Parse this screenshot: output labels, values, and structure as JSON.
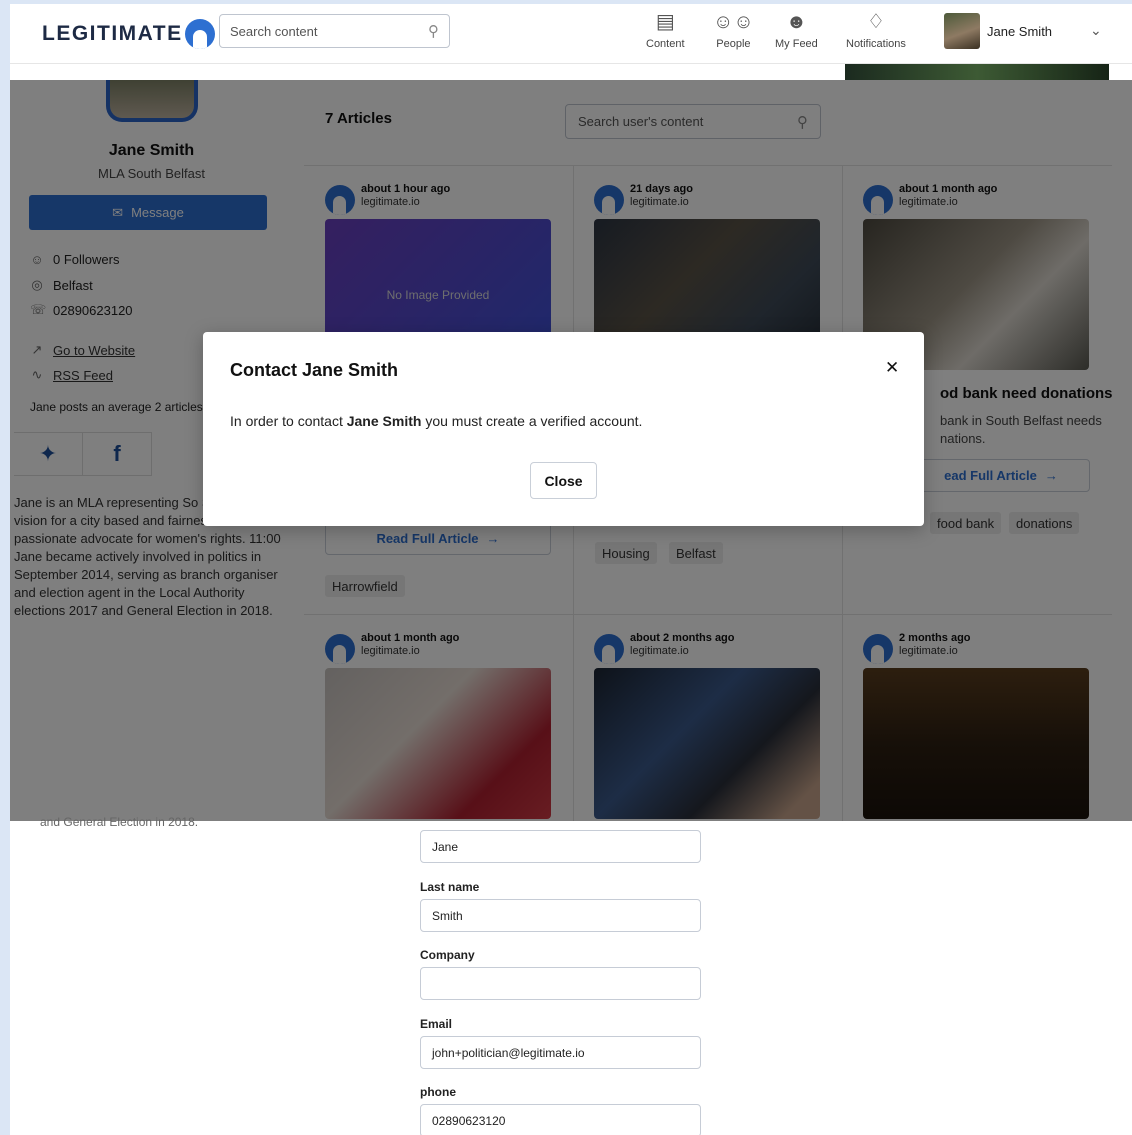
{
  "header": {
    "logo_text": "LEGITIMATE",
    "search_placeholder": "Search content",
    "nav": [
      {
        "label": "Content",
        "icon": "newspaper-icon"
      },
      {
        "label": "People",
        "icon": "people-icon"
      },
      {
        "label": "My Feed",
        "icon": "my-feed-icon"
      },
      {
        "label": "Notifications",
        "icon": "bell-icon"
      }
    ],
    "user_name": "Jane Smith"
  },
  "profile": {
    "name": "Jane Smith",
    "role": "MLA South Belfast",
    "message_label": "Message",
    "followers": "0 Followers",
    "location": "Belfast",
    "phone": "02890623120",
    "website_label": "Go to Website",
    "rss_label": "RSS Feed",
    "avg_posts": "Jane posts an average 2 articles",
    "bio": "Jane is an MLA representing So She has a vision for a city based and fairness and is a passionate advocate for women's rights. 11:00 Jane became actively involved in politics in September 2014, serving as branch organiser and election agent in the Local Authority elections 2017 and General Election in 2018."
  },
  "articles": {
    "count_label": "7 Articles",
    "search_placeholder": "Search user's content",
    "cards": [
      {
        "time": "about 1 hour ago",
        "site": "legitimate.io",
        "no_image": "No Image Provided"
      },
      {
        "time": "21 days ago",
        "site": "legitimate.io"
      },
      {
        "time": "about 1 month ago",
        "site": "legitimate.io",
        "title": "od bank need donations",
        "desc": "bank in South Belfast needs nations."
      },
      {
        "time": "about 1 month ago",
        "site": "legitimate.io"
      },
      {
        "time": "about 2 months ago",
        "site": "legitimate.io"
      },
      {
        "time": "2 months ago",
        "site": "legitimate.io"
      }
    ],
    "read_full": "Read Full Article",
    "read_full_partial": "ead Full Article",
    "tags_card1": [
      "Harrowfield"
    ],
    "tags_card2": [
      "Housing",
      "Belfast"
    ],
    "tags_card3": [
      "food bank",
      "donations"
    ]
  },
  "modal": {
    "title": "Contact Jane Smith",
    "body_prefix": "In order to contact ",
    "body_name": "Jane Smith",
    "body_suffix": " you must create a verified account.",
    "close_label": "Close"
  },
  "form": {
    "bio_cut": "and General Election in 2018.",
    "first_name_value": "Jane",
    "last_name_label": "Last name",
    "last_name_value": "Smith",
    "company_label": "Company",
    "company_value": "",
    "email_label": "Email",
    "email_value": "john+politician@legitimate.io",
    "phone_label": "phone",
    "phone_value": "02890623120"
  }
}
